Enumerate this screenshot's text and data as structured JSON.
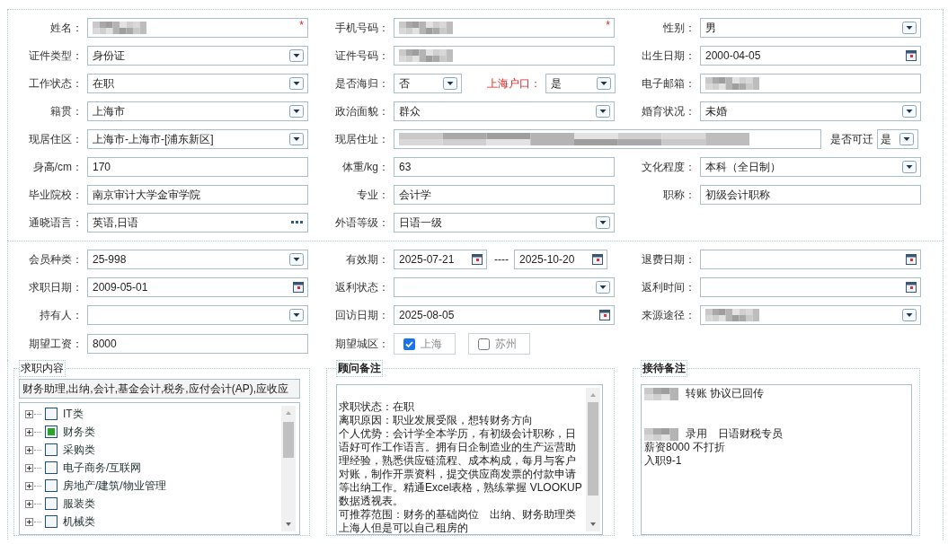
{
  "basic_info": {
    "rows": [
      {
        "cells": [
          {
            "fields": [
              {
                "label": "姓名：",
                "kind": "text",
                "blurred": true,
                "required": true,
                "mark": "*"
              }
            ]
          },
          {
            "fields": [
              {
                "label": "手机号码：",
                "kind": "text",
                "blurred": true,
                "required": true,
                "mark": "*"
              }
            ]
          },
          {
            "fields": [
              {
                "label": "性别：",
                "kind": "select",
                "value": "男"
              }
            ]
          }
        ]
      },
      {
        "cells": [
          {
            "fields": [
              {
                "label": "证件类型：",
                "kind": "select",
                "value": "身份证"
              }
            ]
          },
          {
            "fields": [
              {
                "label": "证件号码：",
                "kind": "text",
                "blurred": true
              }
            ]
          },
          {
            "fields": [
              {
                "label": "出生日期：",
                "kind": "date",
                "value": "2000-04-05"
              }
            ]
          }
        ]
      },
      {
        "cells": [
          {
            "fields": [
              {
                "label": "工作状态：",
                "kind": "select",
                "value": "在职"
              }
            ]
          },
          {
            "kind": "pair",
            "fields": [
              {
                "label": "是否海归：",
                "kind": "select",
                "value": "否"
              },
              {
                "label": "上海户口：",
                "kind": "select",
                "value": "是",
                "highlight": true
              }
            ]
          },
          {
            "fields": [
              {
                "label": "电子邮箱：",
                "kind": "text",
                "blurred": true
              }
            ]
          }
        ]
      },
      {
        "cells": [
          {
            "fields": [
              {
                "label": "籍贯：",
                "kind": "select",
                "value": "上海市"
              }
            ]
          },
          {
            "fields": [
              {
                "label": "政治面貌：",
                "kind": "select",
                "value": "群众"
              }
            ]
          },
          {
            "fields": [
              {
                "label": "婚育状况：",
                "kind": "select",
                "value": "未婚"
              }
            ]
          }
        ]
      },
      {
        "cells": [
          {
            "fields": [
              {
                "label": "现居住区：",
                "kind": "select",
                "value": "上海市-上海市-[浦东新区]"
              }
            ]
          },
          {
            "kind": "span",
            "fields": [
              {
                "label": "现居住址：",
                "kind": "text",
                "blurred": true
              },
              {
                "label": "是否可迁",
                "kind": "select",
                "value": "是"
              }
            ]
          }
        ]
      },
      {
        "cells": [
          {
            "fields": [
              {
                "label": "身高/cm：",
                "kind": "text",
                "value": "170"
              }
            ]
          },
          {
            "fields": [
              {
                "label": "体重/kg：",
                "kind": "text",
                "value": "63"
              }
            ]
          },
          {
            "fields": [
              {
                "label": "文化程度：",
                "kind": "select",
                "value": "本科（全日制）"
              }
            ]
          }
        ]
      },
      {
        "cells": [
          {
            "fields": [
              {
                "label": "毕业院校：",
                "kind": "text",
                "value": "南京审计大学金审学院"
              }
            ]
          },
          {
            "fields": [
              {
                "label": "专业：",
                "kind": "text",
                "value": "会计学"
              }
            ]
          },
          {
            "fields": [
              {
                "label": "职称：",
                "kind": "text",
                "value": "初级会计职称"
              }
            ]
          }
        ]
      },
      {
        "cells": [
          {
            "fields": [
              {
                "label": "通晓语言：",
                "kind": "multi",
                "value": "英语,日语"
              }
            ]
          },
          {
            "fields": [
              {
                "label": "外语等级：",
                "kind": "select",
                "value": "日语一级"
              }
            ]
          }
        ]
      }
    ]
  },
  "membership": {
    "rows": [
      {
        "cells": [
          {
            "fields": [
              {
                "label": "会员种类：",
                "kind": "select",
                "value": "25-998"
              }
            ]
          },
          {
            "fields": [
              {
                "label": "有效期：",
                "kind": "range",
                "value": "2025-07-21",
                "separator": "----",
                "value_end": "2025-10-20"
              }
            ]
          },
          {
            "fields": [
              {
                "label": "退费日期：",
                "kind": "date"
              }
            ]
          }
        ]
      },
      {
        "cells": [
          {
            "fields": [
              {
                "label": "求职日期：",
                "kind": "date",
                "value": "2009-05-01"
              }
            ]
          },
          {
            "fields": [
              {
                "label": "返利状态：",
                "kind": "select"
              }
            ]
          },
          {
            "fields": [
              {
                "label": "返利时间：",
                "kind": "date"
              }
            ]
          }
        ]
      },
      {
        "cells": [
          {
            "fields": [
              {
                "label": "持有人：",
                "kind": "select"
              }
            ]
          },
          {
            "fields": [
              {
                "label": "回访日期：",
                "kind": "date",
                "value": "2025-08-05"
              }
            ]
          },
          {
            "fields": [
              {
                "label": "来源途径：",
                "kind": "select",
                "blurred": true
              }
            ]
          }
        ]
      },
      {
        "cells": [
          {
            "fields": [
              {
                "label": "期望工资：",
                "kind": "text",
                "value": "8000"
              }
            ]
          },
          {
            "fields": [
              {
                "label": "期望城区：",
                "kind": "checks",
                "options": [
                  {
                    "label": "上海",
                    "checked": true
                  },
                  {
                    "label": "苏州",
                    "checked": false
                  }
                ]
              }
            ]
          }
        ]
      }
    ]
  },
  "job_wanted": {
    "title": "求职内容",
    "summary": "财务助理,出纳,会计,基金会计,税务,应付会计(AP),应收应",
    "tree": [
      {
        "label": "IT类",
        "checked": false,
        "expanded": false
      },
      {
        "label": "财务类",
        "checked": true,
        "expanded": false
      },
      {
        "label": "采购类",
        "checked": false,
        "expanded": false
      },
      {
        "label": "电子商务/互联网",
        "checked": false,
        "expanded": false
      },
      {
        "label": "房地产/建筑/物业管理",
        "checked": false,
        "expanded": false
      },
      {
        "label": "服装类",
        "checked": false,
        "expanded": false
      },
      {
        "label": "机械类",
        "checked": false,
        "expanded": false
      }
    ]
  },
  "advisor_notes": {
    "title": "顾问备注",
    "lines": [
      {
        "kind": "blank"
      },
      {
        "kind": "text",
        "text": "求职状态：在职"
      },
      {
        "kind": "text",
        "text": "离职原因：职业发展受限，想转财务方向"
      },
      {
        "kind": "text",
        "text": "个人优势：会计学全本学历，有初级会计职称，日语好可作工作语言。拥有日企制造业的生产运营助理经验，熟悉供应链流程、成本构成，每月与客户对账，制作开票资料，提交供应商发票的付款申请等出纳工作。精通Excel表格，熟练掌握 VLOOKUP数据透视表。"
      },
      {
        "kind": "text",
        "text": "可推荐范围：财务的基础岗位　出纳、财务助理类"
      },
      {
        "kind": "text",
        "text": "上海人但是可以自己租房的"
      }
    ]
  },
  "reception_notes": {
    "title": "接待备注",
    "lines": [
      {
        "kind": "text",
        "text": "转账  协议已回传",
        "blurred": true
      },
      {
        "kind": "blank"
      },
      {
        "kind": "blank"
      },
      {
        "kind": "text",
        "text": "录用　日语财税专员",
        "blurred": true
      },
      {
        "kind": "text",
        "text": "薪资8000 不打折"
      },
      {
        "kind": "text",
        "text": "入职9-1"
      }
    ]
  }
}
